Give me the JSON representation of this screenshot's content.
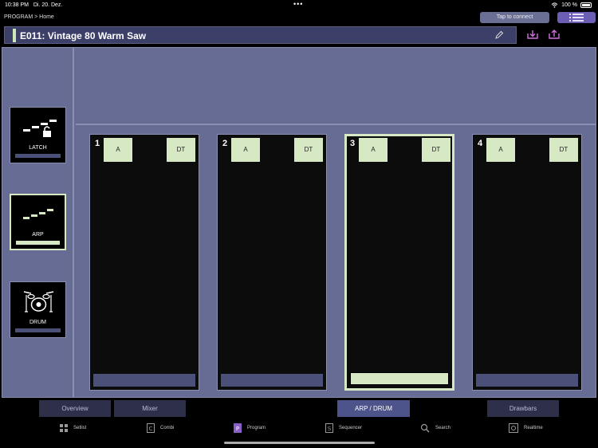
{
  "status": {
    "time": "10:38 PM",
    "date": "Di. 20. Dez.",
    "battery": "100 %"
  },
  "breadcrumb": "PROGRAM > Home",
  "header": {
    "connect_label": "Tap to connect"
  },
  "program": {
    "name": "E011: Vintage 80 Warm Saw"
  },
  "modes": [
    {
      "label": "LATCH",
      "icon": "latch-icon",
      "active": false
    },
    {
      "label": "ARP",
      "icon": "arp-icon",
      "active": true
    },
    {
      "label": "DRUM",
      "icon": "drum-kit-icon",
      "active": false
    }
  ],
  "slots": [
    {
      "number": "1",
      "a_label": "A",
      "dt_label": "DT"
    },
    {
      "number": "2",
      "a_label": "A",
      "dt_label": "DT"
    },
    {
      "number": "3",
      "a_label": "A",
      "dt_label": "DT",
      "selected": true
    },
    {
      "number": "4",
      "a_label": "A",
      "dt_label": "DT"
    }
  ],
  "tabs": [
    {
      "label": "Overview"
    },
    {
      "label": "Mixer"
    },
    {
      "label": "ARP / DRUM",
      "active": true
    },
    {
      "label": "Drawbars"
    }
  ],
  "nav": [
    {
      "label": "Setlist",
      "icon": "setlist-icon"
    },
    {
      "label": "Combi",
      "icon": "combi-icon"
    },
    {
      "label": "Program",
      "icon": "program-icon"
    },
    {
      "label": "Sequencer",
      "icon": "sequencer-icon"
    },
    {
      "label": "Search",
      "icon": "search-icon"
    },
    {
      "label": "Realtime",
      "icon": "realtime-icon"
    }
  ],
  "colors": {
    "accent_green": "#d7e8c4",
    "panel": "#676c95",
    "accent_purple": "#6b5fb5"
  }
}
